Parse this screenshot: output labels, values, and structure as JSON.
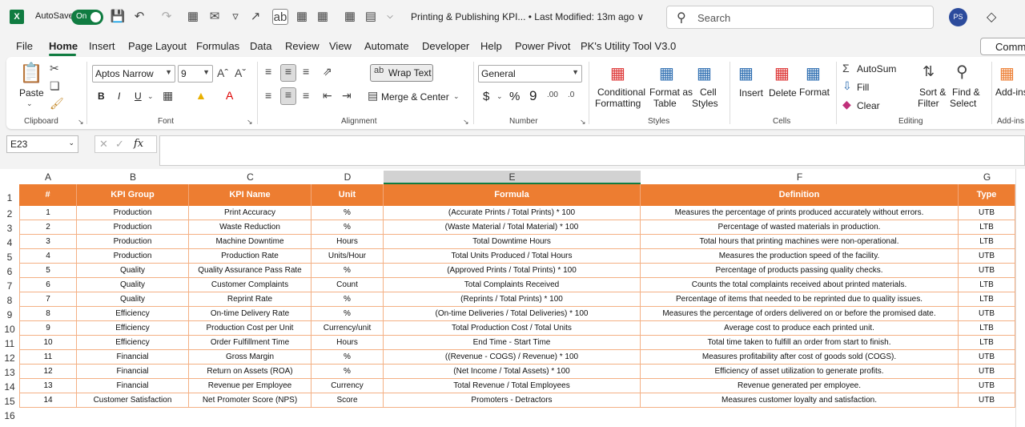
{
  "titlebar": {
    "app_icon": "X",
    "autosave_label": "AutoSave",
    "autosave_state": "On",
    "doc_title": "Printing & Publishing KPI... • Last Modified: 13m ago ∨",
    "search_placeholder": "Search",
    "avatar_initials": "PS"
  },
  "menu": {
    "tabs": [
      "File",
      "Home",
      "Insert",
      "Page Layout",
      "Formulas",
      "Data",
      "Review",
      "View",
      "Automate",
      "Developer",
      "Help",
      "Power Pivot",
      "PK's Utility Tool V3.0"
    ],
    "active": "Home",
    "comments_label": "Comm"
  },
  "ribbon": {
    "clipboard": {
      "paste": "Paste",
      "label": "Clipboard"
    },
    "font": {
      "name": "Aptos Narrow",
      "size": "9",
      "label": "Font",
      "bold": "B",
      "italic": "I",
      "underline": "U"
    },
    "alignment": {
      "wrap_text": "Wrap Text",
      "merge_center": "Merge & Center",
      "label": "Alignment"
    },
    "number": {
      "format": "General",
      "label": "Number",
      "currency": "$",
      "percent": "%",
      "comma": "9"
    },
    "styles": {
      "conditional": "Conditional",
      "conditional2": "Formatting",
      "format_table": "Format as",
      "format_table2": "Table",
      "cell_styles": "Cell",
      "cell_styles2": "Styles",
      "label": "Styles"
    },
    "cells": {
      "insert": "Insert",
      "delete": "Delete",
      "format": "Format",
      "label": "Cells"
    },
    "editing": {
      "autosum": "AutoSum",
      "fill": "Fill",
      "clear": "Clear",
      "sort": "Sort &",
      "sort2": "Filter",
      "find": "Find &",
      "find2": "Select",
      "label": "Editing"
    },
    "addins": {
      "label1": "Add-ins",
      "label2": "Add-ins"
    }
  },
  "formula_bar": {
    "cell_ref": "E23",
    "fx": "fx",
    "formula": ""
  },
  "grid": {
    "columns": [
      "A",
      "B",
      "C",
      "D",
      "E",
      "F",
      "G"
    ],
    "selected_column": "E",
    "header_color": "#ed7d31",
    "headers": [
      "#",
      "KPI Group",
      "KPI Name",
      "Unit",
      "Formula",
      "Definition",
      "Type"
    ],
    "row_numbers": [
      "1",
      "2",
      "3",
      "4",
      "5",
      "6",
      "7",
      "8",
      "9",
      "10",
      "11",
      "12",
      "13",
      "14",
      "15",
      "16"
    ],
    "rows": [
      [
        "1",
        "Production",
        "Print Accuracy",
        "%",
        "(Accurate Prints / Total Prints) * 100",
        "Measures the percentage of prints produced accurately without errors.",
        "UTB"
      ],
      [
        "2",
        "Production",
        "Waste Reduction",
        "%",
        "(Waste Material / Total Material) * 100",
        "Percentage of wasted materials in production.",
        "LTB"
      ],
      [
        "3",
        "Production",
        "Machine Downtime",
        "Hours",
        "Total Downtime Hours",
        "Total hours that printing machines were non-operational.",
        "LTB"
      ],
      [
        "4",
        "Production",
        "Production Rate",
        "Units/Hour",
        "Total Units Produced / Total Hours",
        "Measures the production speed of the facility.",
        "UTB"
      ],
      [
        "5",
        "Quality",
        "Quality Assurance Pass Rate",
        "%",
        "(Approved Prints / Total Prints) * 100",
        "Percentage of products passing quality checks.",
        "UTB"
      ],
      [
        "6",
        "Quality",
        "Customer Complaints",
        "Count",
        "Total Complaints Received",
        "Counts the total complaints received about printed materials.",
        "LTB"
      ],
      [
        "7",
        "Quality",
        "Reprint Rate",
        "%",
        "(Reprints / Total Prints) * 100",
        "Percentage of items that needed to be reprinted due to quality issues.",
        "LTB"
      ],
      [
        "8",
        "Efficiency",
        "On-time Delivery Rate",
        "%",
        "(On-time Deliveries / Total Deliveries) * 100",
        "Measures the percentage of orders delivered on or before the promised date.",
        "UTB"
      ],
      [
        "9",
        "Efficiency",
        "Production Cost per Unit",
        "Currency/unit",
        "Total Production Cost / Total Units",
        "Average cost to produce each printed unit.",
        "LTB"
      ],
      [
        "10",
        "Efficiency",
        "Order Fulfillment Time",
        "Hours",
        "End Time - Start Time",
        "Total time taken to fulfill an order from start to finish.",
        "LTB"
      ],
      [
        "11",
        "Financial",
        "Gross Margin",
        "%",
        "((Revenue - COGS) / Revenue) * 100",
        "Measures profitability after cost of goods sold (COGS).",
        "UTB"
      ],
      [
        "12",
        "Financial",
        "Return on Assets (ROA)",
        "%",
        "(Net Income / Total Assets) * 100",
        "Efficiency of asset utilization to generate profits.",
        "UTB"
      ],
      [
        "13",
        "Financial",
        "Revenue per Employee",
        "Currency",
        "Total Revenue / Total Employees",
        "Revenue generated per employee.",
        "UTB"
      ],
      [
        "14",
        "Customer Satisfaction",
        "Net Promoter Score (NPS)",
        "Score",
        "Promoters - Detractors",
        "Measures customer loyalty and satisfaction.",
        "UTB"
      ]
    ]
  }
}
